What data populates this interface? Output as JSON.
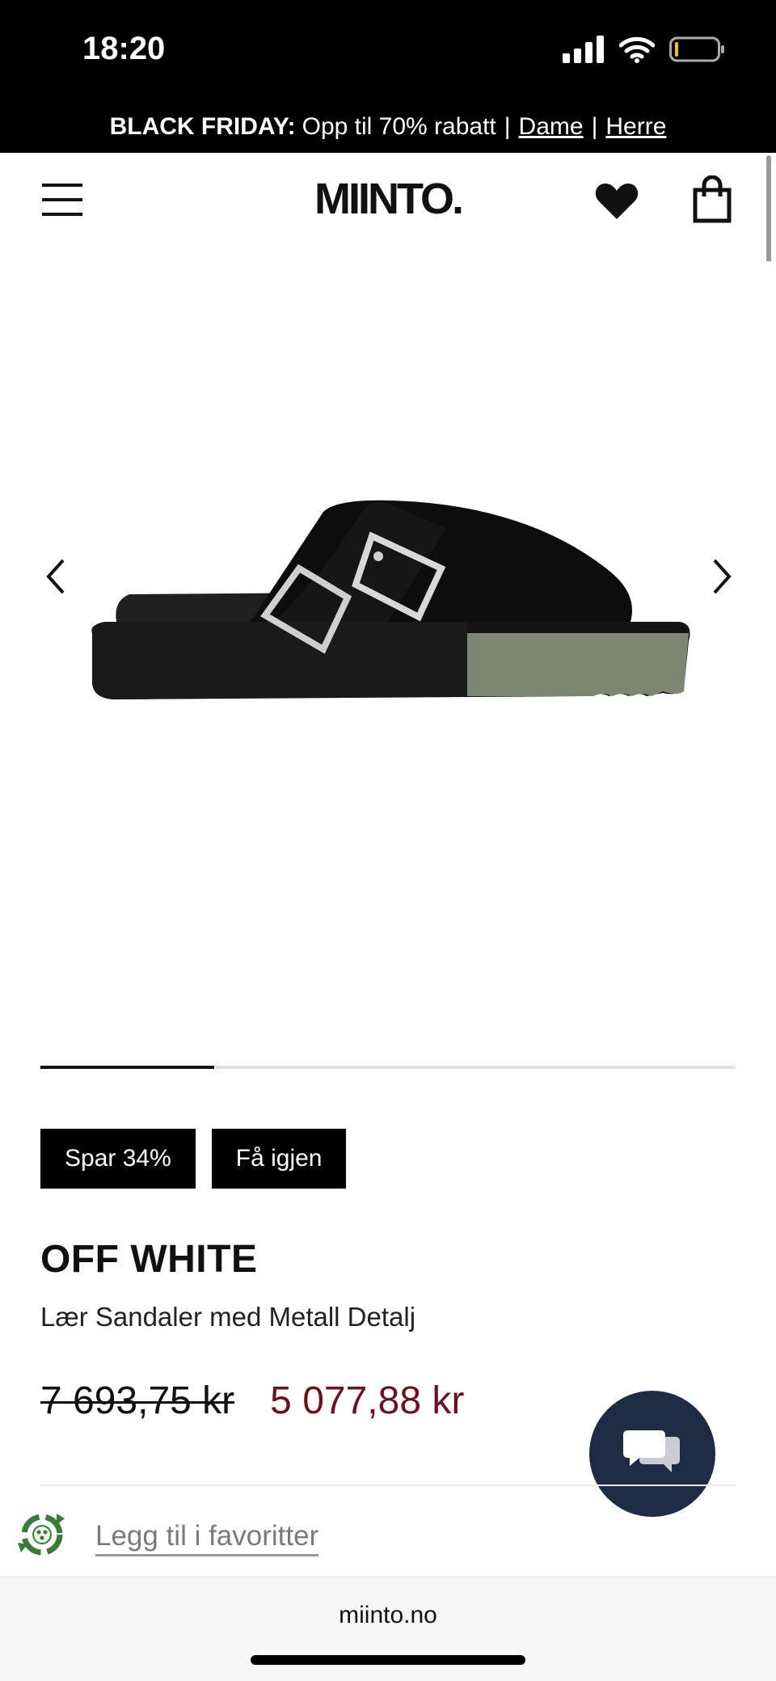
{
  "status_bar": {
    "time": "18:20"
  },
  "banner": {
    "label": "BLACK FRIDAY:",
    "text": "Opp til 70% rabatt",
    "separator": "|",
    "links": [
      "Dame",
      "Herre"
    ]
  },
  "header": {
    "logo": "MIINTO."
  },
  "gallery": {
    "progress": 0.25,
    "product_image": "black-suede-buckle-clog-image"
  },
  "product": {
    "badges": [
      "Spar 34%",
      "Få igjen"
    ],
    "brand": "OFF WHITE",
    "name": "Lær Sandaler med Metall Detalj",
    "original_price": "7 693,75 kr",
    "sale_price": "5 077,88 kr",
    "favorite_label": "Legg til i favoritter"
  },
  "browser": {
    "url": "miinto.no"
  },
  "colors": {
    "sale_price": "#6b1122",
    "chat_button": "#1d2b45",
    "eco_icon": "#3b7a3a"
  },
  "icons": [
    "menu-icon",
    "heart-icon",
    "bag-icon",
    "chevron-left-icon",
    "chevron-right-icon",
    "chat-icon",
    "eco-recycle-icon"
  ]
}
